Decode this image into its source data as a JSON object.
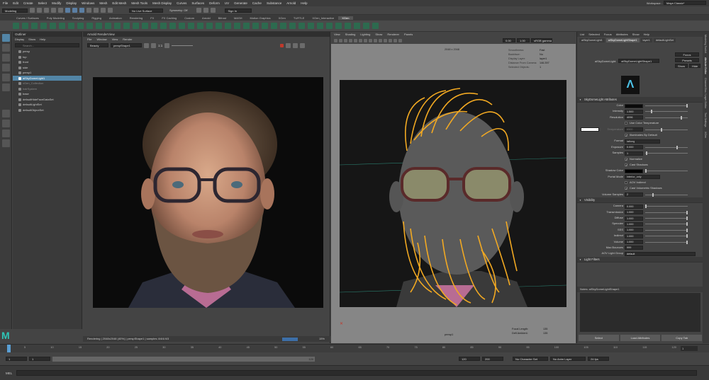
{
  "menubar": {
    "items": [
      "File",
      "Edit",
      "Create",
      "Select",
      "Modify",
      "Display",
      "Windows",
      "Mesh",
      "Edit Mesh",
      "Mesh Tools",
      "Mesh Display",
      "Curves",
      "Surfaces",
      "Deform",
      "UV",
      "Generate",
      "Cache",
      "Substance",
      "Arnold",
      "Help"
    ],
    "workspace_label": "Workspace :",
    "workspace_value": "Maya Classic*"
  },
  "statusline": {
    "mode": "Modeling",
    "live_surface": "No Live Surface",
    "symmetry": "Symmetry: Off",
    "sign_in": "Sign In"
  },
  "shelf": {
    "tabs": [
      "Curves / Surfaces",
      "Poly Modeling",
      "Sculpting",
      "Rigging",
      "Animation",
      "Rendering",
      "FX",
      "FX Caching",
      "Custom",
      "Arnold",
      "Bifrost",
      "MASH",
      "Motion Graphics",
      "XGen",
      "TURTLE",
      "XGen_Interactive",
      "XGen"
    ],
    "active_tab": 16
  },
  "outliner": {
    "title": "Outliner",
    "menu": [
      "Display",
      "Show",
      "Help"
    ],
    "search_placeholder": "Search...",
    "items": [
      {
        "label": "persp",
        "selected": false
      },
      {
        "label": "top",
        "selected": false
      },
      {
        "label": "front",
        "selected": false
      },
      {
        "label": "side",
        "selected": false
      },
      {
        "label": "persp1",
        "selected": false
      },
      {
        "label": "aiSkyDomeLight1",
        "selected": true
      },
      {
        "label": "xGen_Collection",
        "selected": false
      },
      {
        "label": "hairSystem",
        "selected": false
      },
      {
        "label": "base",
        "selected": false
      },
      {
        "label": "defaultHideFaceDataSet",
        "selected": false
      },
      {
        "label": "defaultLightSet",
        "selected": false
      },
      {
        "label": "defaultObjectSet",
        "selected": false
      }
    ]
  },
  "renderview": {
    "title": "Arnold RenderView",
    "menu": [
      "File",
      "Window",
      "View",
      "Render"
    ],
    "aov": "Beauty",
    "camera": "perspShape1",
    "ratio": "1:1",
    "status": "Rendering | 2048x2048 (40%) | perspShape1 | samples 4/4/4/4/3",
    "zoom": "15%"
  },
  "viewport": {
    "menu": [
      "View",
      "Shading",
      "Lighting",
      "Show",
      "Renderer",
      "Panels"
    ],
    "res_label": "2048 x 2048",
    "hud_keys": [
      "Smoothness:",
      "Backface:",
      "Display Layer:",
      "Distance From Camera:",
      "Selected Objects:"
    ],
    "hud_values": [
      "Fast",
      "No",
      "layer1",
      "146.397",
      "1"
    ],
    "camera_name": "persp1",
    "focal_label": "Focal Length:",
    "focal_value": "135",
    "subject_label": "Defl Ambient:",
    "subject_value": "135",
    "near_value": "0.00",
    "far_value": "1.00",
    "color_space": "sRGB gamma"
  },
  "attr": {
    "menu": [
      "List",
      "Selected",
      "Focus",
      "Attributes",
      "Show",
      "Help"
    ],
    "tabs": [
      "aiSkyDomeLight1",
      "aiSkyDomeLightShape1",
      "layer1",
      "defaultLightSet"
    ],
    "active_tab": 1,
    "node_type_label": "aiSkyDomeLight:",
    "node_name": "aiSkyDomeLightShape1",
    "focus": "Focus",
    "presets": "Presets",
    "show": "Show",
    "hide": "Hide",
    "section1": "SkyDomeLight Attributes",
    "color_label": "Color",
    "intensity_label": "Intensity",
    "intensity_value": "1.500",
    "resolution_label": "Resolution",
    "resolution_value": "4096",
    "use_color_temp": "Use Color Temperature",
    "temperature_label": "Temperature",
    "temperature_value": "6500",
    "illuminates": "Illuminates By Default",
    "format_label": "Format",
    "format_value": "latlong",
    "exposure_label": "Exposure",
    "exposure_value": "0.000",
    "samples_label": "Samples",
    "samples_value": "1",
    "normalize": "Normalize",
    "cast_shadows": "Cast Shadows",
    "shadow_color_label": "Shadow Color",
    "portal_mode_label": "Portal Mode",
    "portal_mode_value": "interior_only",
    "aov_indirect": "AOV Indirect",
    "cast_volumetric": "Cast Volumetric Shadows",
    "volume_samples_label": "Volume Samples",
    "volume_samples_value": "2",
    "section2": "Visibility",
    "vis_labels": [
      "Camera",
      "Transmission",
      "Diffuse",
      "Specular",
      "SSS",
      "Indirect",
      "Volume"
    ],
    "vis_values": [
      "0.000",
      "1.000",
      "1.000",
      "1.000",
      "1.000",
      "1.000",
      "1.000"
    ],
    "max_bounces_label": "Max Bounces",
    "max_bounces_value": "999",
    "aov_group_label": "AOV Light Group",
    "aov_group_value": "default",
    "section3": "Light Filters",
    "notes_label": "Notes: aiSkyDomeLightShape1",
    "buttons": [
      "Select",
      "Load Attributes",
      "Copy Tab"
    ],
    "colors": {
      "color_swatch": "#0a0a0a",
      "temp_swatch": "#ffffff",
      "shadow_swatch": "#000000"
    }
  },
  "right_tabs": [
    "Modeling Toolkit",
    "Attribute Editor",
    "Channel Box / Layer Editor",
    "Tool Settings",
    "XGen"
  ],
  "timeline": {
    "ticks": [
      "5",
      "10",
      "15",
      "20",
      "25",
      "30",
      "35",
      "40",
      "45",
      "50",
      "55",
      "60",
      "65",
      "70",
      "75",
      "80",
      "85",
      "90",
      "95",
      "100",
      "105",
      "110",
      "115",
      "120"
    ],
    "current_frame": "1"
  },
  "range": {
    "start": "1",
    "start_inner": "1",
    "end_inner": "120",
    "end": "120",
    "end_outer": "200",
    "char_set": "No Character Set",
    "anim_layer": "No Anim Layer",
    "fps": "24 fps"
  },
  "cmdline": {
    "label": "MEL"
  }
}
